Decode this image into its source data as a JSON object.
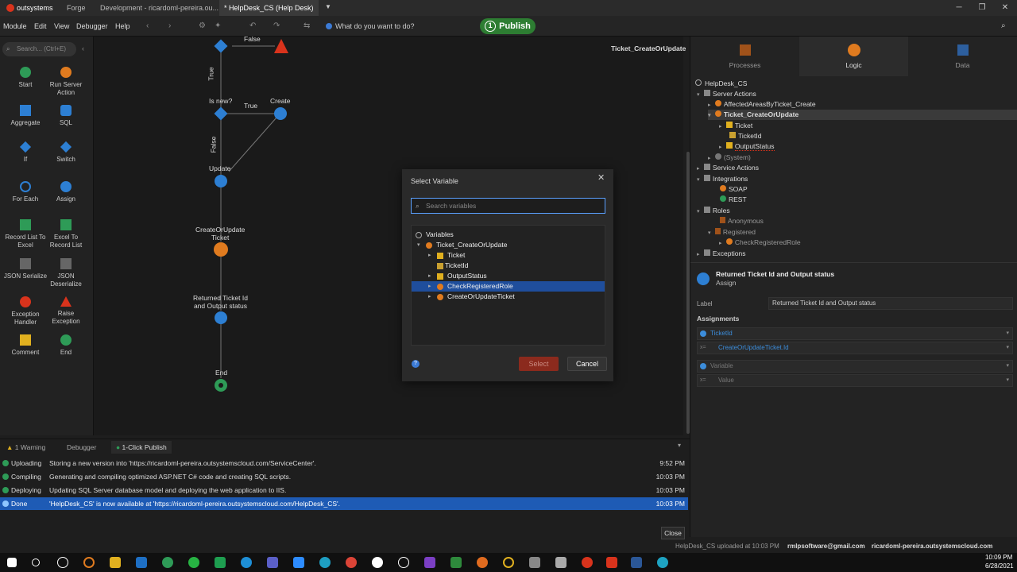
{
  "titlebar": {
    "brand": "outsystems",
    "tabs": [
      "Forge",
      "Development - ricardoml-pereira.ou...",
      "* HelpDesk_CS (Help Desk)"
    ]
  },
  "menubar": {
    "items": [
      "Module",
      "Edit",
      "View",
      "Debugger",
      "Help"
    ],
    "prompt": "What do you want to do?",
    "publish_step": "1",
    "publish_label": "Publish"
  },
  "toolbox": {
    "search_placeholder": "Search... (Ctrl+E)",
    "items": [
      "Start",
      "Run Server Action",
      "Aggregate",
      "SQL",
      "If",
      "Switch",
      "For Each",
      "Assign",
      "Record List To Excel",
      "Excel To Record List",
      "JSON Serialize",
      "JSON Deserialize",
      "Exception Handler",
      "Raise Exception",
      "Comment",
      "End"
    ]
  },
  "canvas": {
    "title": "Ticket_CreateOrUpdate",
    "labels": {
      "false_top": "False",
      "true1": "True",
      "is_new": "Is new?",
      "true2": "True",
      "create": "Create",
      "false2": "False",
      "update": "Update",
      "create_or_update": "CreateOrUpdate\nTicket",
      "returned": "Returned Ticket Id\nand Output status",
      "end": "End"
    }
  },
  "modal": {
    "title": "Select Variable",
    "search_placeholder": "Search variables",
    "tree": [
      "Variables",
      "Ticket_CreateOrUpdate",
      "Ticket",
      "TicketId",
      "OutputStatus",
      "CheckRegisteredRole",
      "CreateOrUpdateTicket"
    ],
    "select_label": "Select",
    "cancel_label": "Cancel"
  },
  "rightpanel": {
    "tabs": [
      "Processes",
      "Logic",
      "Data"
    ],
    "tree": [
      "HelpDesk_CS",
      "Server Actions",
      "AffectedAreasByTicket_Create",
      "Ticket_CreateOrUpdate",
      "Ticket",
      "TicketId",
      "OutputStatus",
      "(System)",
      "Service Actions",
      "Integrations",
      "SOAP",
      "REST",
      "Roles",
      "Anonymous",
      "Registered",
      "CheckRegisteredRole",
      "Exceptions"
    ],
    "element_title": "Returned Ticket Id and Output status",
    "element_type": "Assign",
    "label_caption": "Label",
    "label_value": "Returned Ticket Id and Output status",
    "assignments_title": "Assignments",
    "assignments": [
      "TicketId",
      "CreateOrUpdateTicket.Id",
      "Variable",
      "Value"
    ]
  },
  "bottom": {
    "tabs": [
      "1 Warning",
      "Debugger",
      "1-Click Publish"
    ],
    "logs": [
      {
        "status": "Uploading",
        "message": "Storing a new version into 'https://ricardoml-pereira.outsystemscloud.com/ServiceCenter'.",
        "time": "9:52 PM"
      },
      {
        "status": "Compiling",
        "message": "Generating and compiling optimized ASP.NET C# code and creating SQL scripts.",
        "time": "10:03 PM"
      },
      {
        "status": "Deploying",
        "message": "Updating SQL Server database model and deploying the web application to IIS.",
        "time": "10:03 PM"
      },
      {
        "status": "Done",
        "message": "'HelpDesk_CS' is now available at 'https://ricardoml-pereira.outsystemscloud.com/HelpDesk_CS'.",
        "time": "10:03 PM"
      }
    ],
    "close_label": "Close"
  },
  "statusline": {
    "uploaded": "HelpDesk_CS uploaded at 10:03 PM",
    "user": "rmlpsoftware@gmail.com",
    "server": "ricardoml-pereira.outsystemscloud.com"
  },
  "taskbar": {
    "time": "10:09 PM",
    "date": "6/28/2021"
  },
  "colors": {
    "accent_blue": "#1e5bb5",
    "publish_green": "#2d7d32",
    "flow_blue": "#2d7fd3",
    "logic_orange": "#e07b1f"
  }
}
